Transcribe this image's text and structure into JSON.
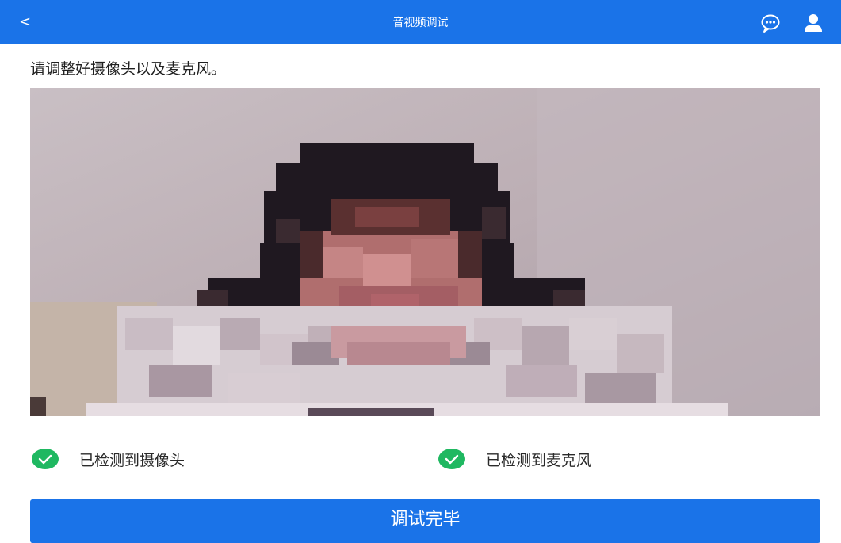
{
  "header": {
    "back_symbol": "<",
    "title": "音视频调试",
    "chat_icon": "chat-bubble-icon",
    "user_icon": "user-icon"
  },
  "instruction": "请调整好摄像头以及麦克风。",
  "video": {
    "content": "camera-preview-pixelated-person"
  },
  "status": {
    "camera_label": "已检测到摄像头",
    "microphone_label": "已检测到麦克风",
    "check_icon": "check-circle-icon",
    "check_color": "#1fb861"
  },
  "actions": {
    "finish_label": "调试完毕"
  },
  "colors": {
    "primary": "#1a73e8",
    "text": "#1f1f1f"
  }
}
